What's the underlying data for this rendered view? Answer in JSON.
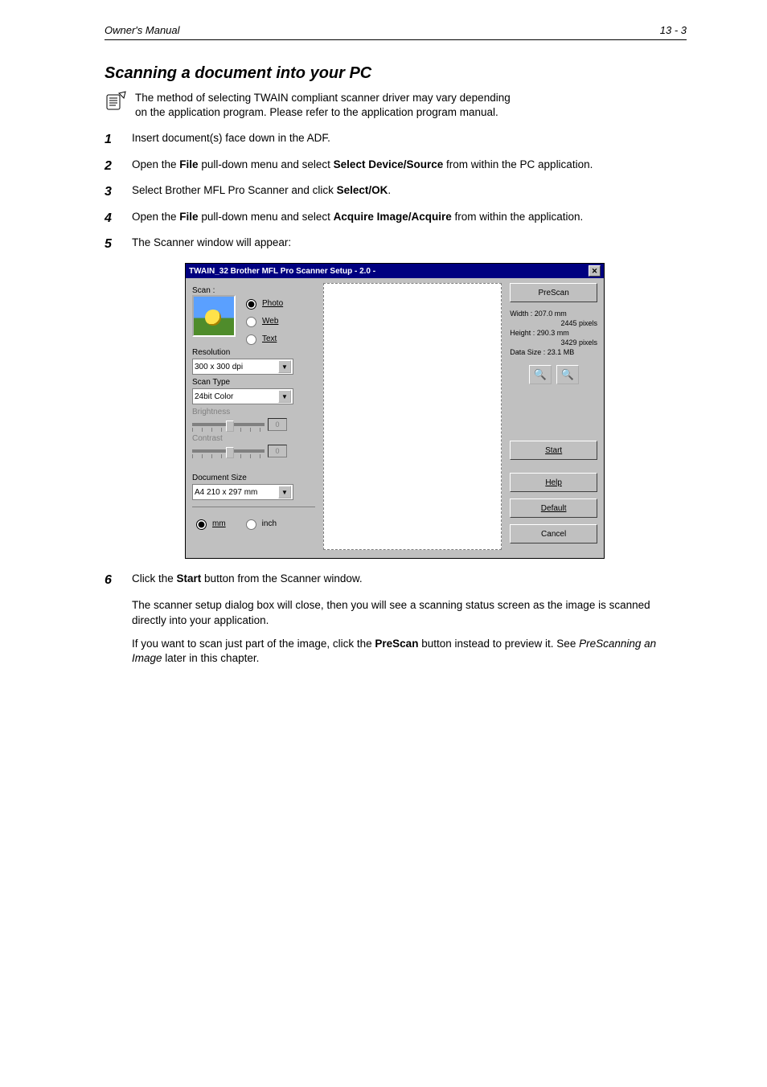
{
  "header": {
    "left": "Owner's Manual",
    "right": "13 - 3"
  },
  "section": {
    "title": "Scanning a document into your PC"
  },
  "note": {
    "line1": "The method of selecting TWAIN compliant scanner driver may vary depending",
    "line2": "on the application program. Please refer to the application program manual."
  },
  "list": {
    "i1": {
      "num": "1",
      "text": "Insert document(s) face down in the ADF."
    },
    "i2": {
      "num": "2",
      "text_before": "Open the ",
      "kw1": "File",
      "text_mid1": " pull-down menu and select ",
      "kw2": "Select Device/Source",
      "text_mid2": " from within the PC application."
    },
    "i3": {
      "num": "3",
      "text_before": "Select Brother MFL Pro Scanner and click ",
      "kw1": "Select/OK",
      "text_after": "."
    },
    "i4": {
      "num": "4",
      "text_before": "Open the ",
      "kw1": "File",
      "text_mid1": " pull-down menu and select ",
      "kw2": "Acquire Image/Acquire",
      "text_mid2": " from within the application."
    },
    "i5": {
      "num": "5",
      "text": "The Scanner window will appear:"
    }
  },
  "dialog": {
    "title": "TWAIN_32 Brother MFL Pro Scanner Setup - 2.0 -",
    "scan_label": "Scan :",
    "radios": {
      "photo": "Photo",
      "web": "Web",
      "text": "Text"
    },
    "resolution_label": "Resolution",
    "resolution_value": "300 x 300 dpi",
    "scantype_label": "Scan Type",
    "scantype_value": "24bit Color",
    "brightness_label": "Brightness",
    "brightness_value": "0",
    "contrast_label": "Contrast",
    "contrast_value": "0",
    "docsize_label": "Document Size",
    "docsize_value": "A4 210 x 297 mm",
    "unit_mm": "mm",
    "unit_inch": "inch",
    "prescan_btn": "PreScan",
    "width_line": "Width :   207.0 mm",
    "width_px": "2445 pixels",
    "height_line": "Height :  290.3 mm",
    "height_px": "3429 pixels",
    "data_line": "Data Size :   23.1 MB",
    "start_btn": "Start",
    "help_btn": "Help",
    "default_btn": "Default",
    "cancel_btn": "Cancel"
  },
  "para": {
    "p6_num": "6",
    "p6_before": "Click the ",
    "p6_kw": "Start",
    "p6_after": " button from the Scanner window.",
    "p7": "The scanner setup dialog box will close, then you will see a scanning status screen as the image is scanned directly into your application.",
    "p8_before": "If you want to scan just part of the image, click the ",
    "p8_kw": "PreScan",
    "p8_mid": " button instead to preview it. See ",
    "p8_em": "PreScanning an Image",
    "p8_after": " later in this chapter."
  }
}
